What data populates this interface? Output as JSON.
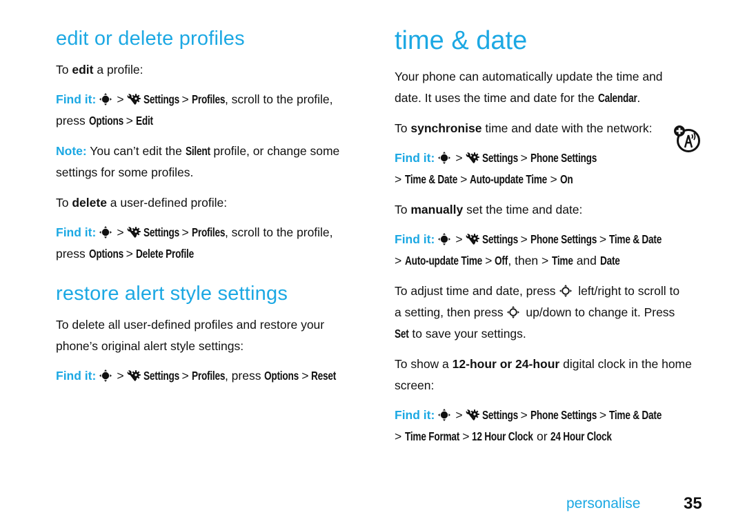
{
  "left": {
    "edit_heading": "edit or delete profiles",
    "edit_intro": {
      "pre": "To ",
      "bold": "edit",
      "post": " a profile:"
    },
    "edit_find": {
      "find_label": "Find it:",
      "settings": "Settings",
      "profiles": "Profiles",
      "mid": ", scroll to the profile,",
      "line2_pre": "press ",
      "options": "Options",
      "action": "Edit"
    },
    "note": {
      "label": "Note:",
      "pre": " You can’t edit the ",
      "silent": "Silent",
      "post": " profile, or change some",
      "line2": "settings for some profiles."
    },
    "delete_intro": {
      "pre": "To ",
      "bold": "delete",
      "post": " a user-defined profile:"
    },
    "delete_find": {
      "find_label": "Find it:",
      "settings": "Settings",
      "profiles": "Profiles",
      "mid": ", scroll to the profile,",
      "line2_pre": "press ",
      "options": "Options",
      "action": "Delete Profile"
    },
    "restore_heading": "restore alert style settings",
    "restore_text_1": "To delete all user-defined profiles and restore your",
    "restore_text_2": "phone’s original alert style settings:",
    "restore_find": {
      "find_label": "Find it:",
      "settings": "Settings",
      "profiles": "Profiles",
      "mid": ", press ",
      "options": "Options",
      "action": "Reset"
    }
  },
  "right": {
    "heading": "time & date",
    "intro_1": "Your phone can automatically update the time and",
    "intro_2_pre": "date. It uses the time and date for the ",
    "intro_2_calendar": "Calendar",
    "intro_2_post": ".",
    "sync_intro": {
      "pre": "To ",
      "bold": "synchronise",
      "post": " time and date with the network:"
    },
    "sync_find": {
      "find_label": "Find it:",
      "settings": "Settings",
      "phone_settings": "Phone Settings",
      "time_date": "Time & Date",
      "auto_update": "Auto-update Time",
      "value": "On"
    },
    "manual_intro": {
      "pre": "To ",
      "bold": "manually",
      "post": " set the time and date:"
    },
    "manual_find": {
      "find_label": "Find it:",
      "settings": "Settings",
      "phone_settings": "Phone Settings",
      "time_date": "Time & Date",
      "auto_update": "Auto-update Time",
      "value": "Off",
      "then": ", then ",
      "time": "Time",
      "and": " and ",
      "date": "Date"
    },
    "adjust_1_pre": "To adjust time and date, press ",
    "adjust_1_post": " left/right to scroll to",
    "adjust_2_pre": "a setting, then press ",
    "adjust_2_post": " up/down to change it. Press",
    "adjust_3_set": "Set",
    "adjust_3_post": " to save your settings.",
    "clock_intro_pre": "To show a ",
    "clock_intro_bold": "12-hour or 24-hour",
    "clock_intro_post": " digital clock in the home",
    "clock_intro_2": "screen:",
    "clock_find": {
      "find_label": "Find it:",
      "settings": "Settings",
      "phone_settings": "Phone Settings",
      "time_date": "Time & Date",
      "time_format": "Time Format",
      "opt_12": "12 Hour Clock",
      "or": " or ",
      "opt_24": "24 Hour Clock"
    }
  },
  "footer": {
    "section": "personalise",
    "page_number": "35"
  },
  "symbols": {
    "gt": ">"
  },
  "colors": {
    "accent": "#1ca8e3",
    "text": "#111111"
  }
}
